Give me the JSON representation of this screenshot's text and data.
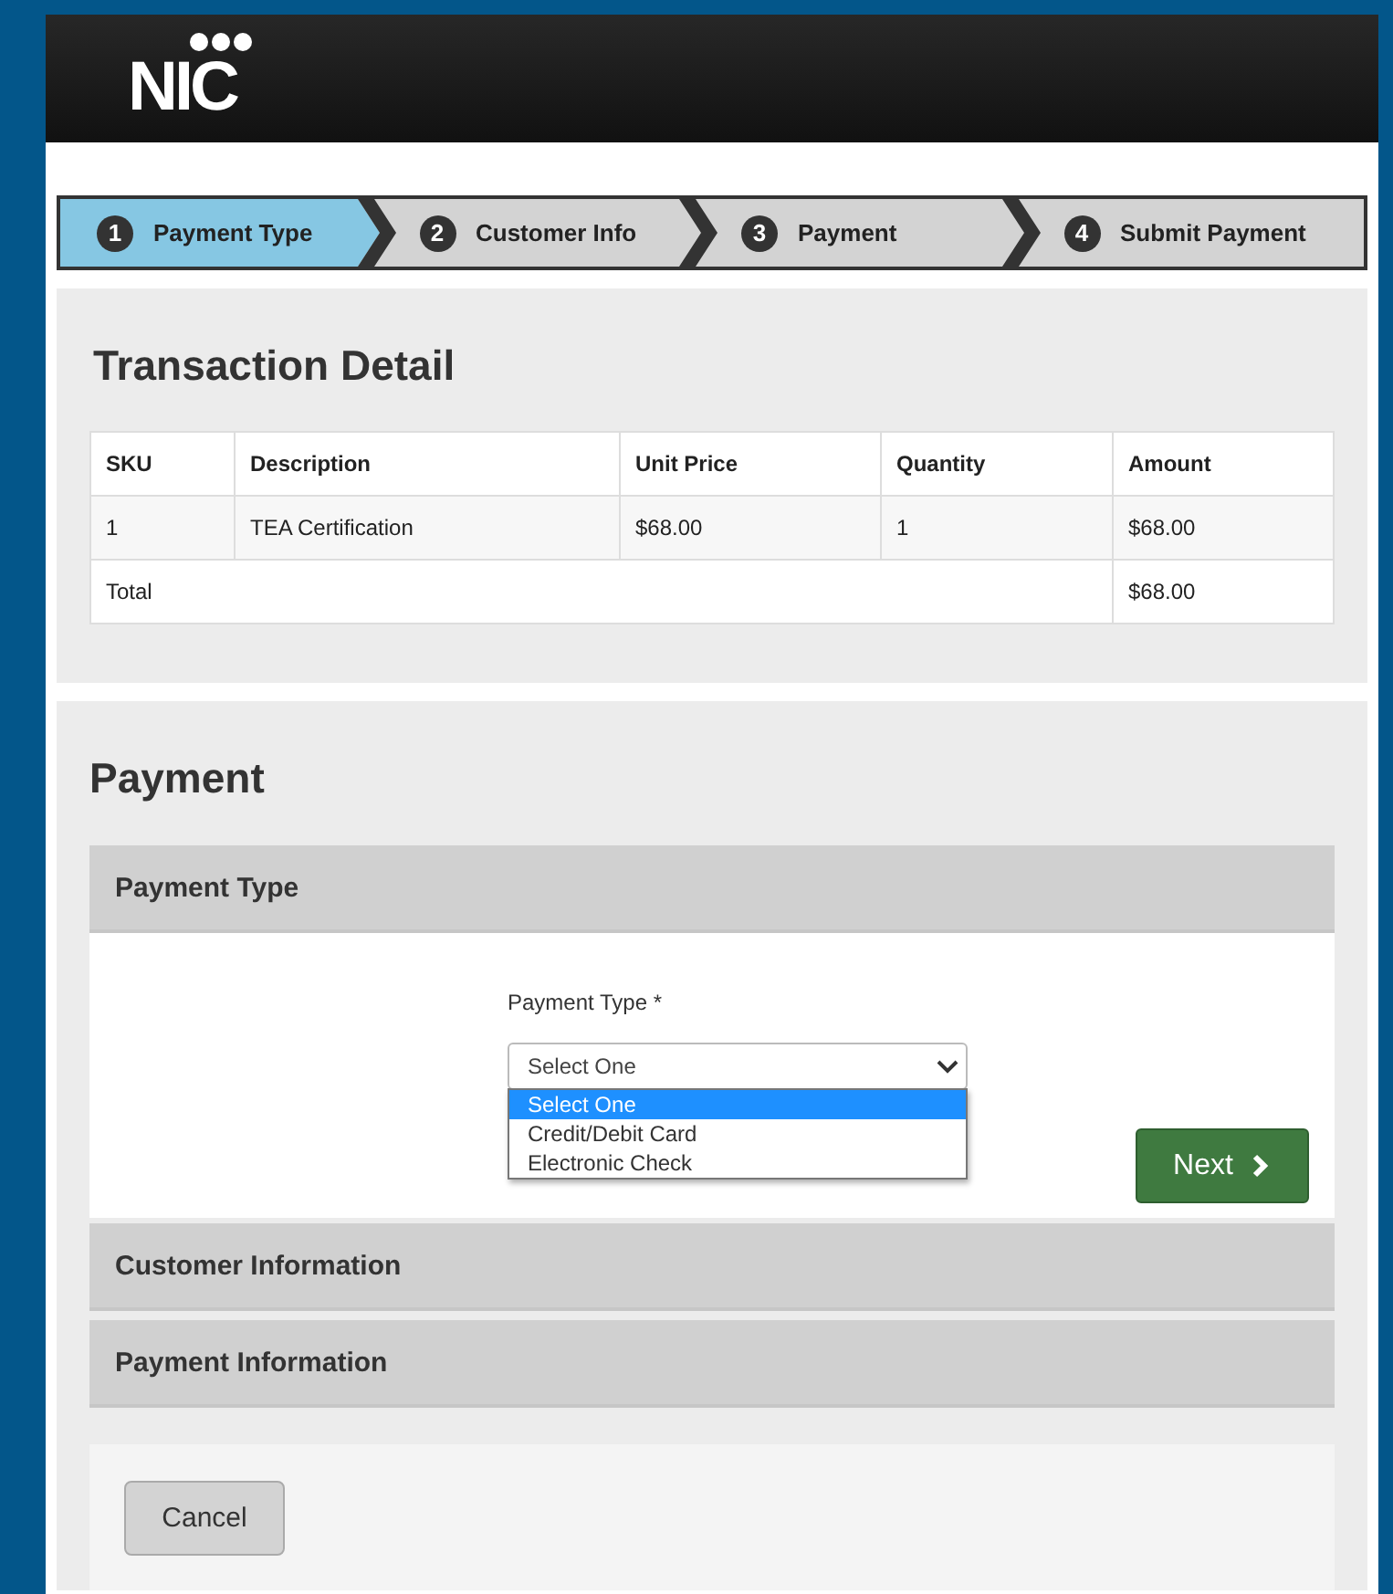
{
  "header": {
    "logo": "NIC"
  },
  "steps": [
    {
      "number": "1",
      "label": "Payment Type",
      "selected": true
    },
    {
      "number": "2",
      "label": "Customer Info",
      "selected": false
    },
    {
      "number": "3",
      "label": "Payment",
      "selected": false
    },
    {
      "number": "4",
      "label": "Submit Payment",
      "selected": false
    }
  ],
  "transaction": {
    "title": "Transaction Detail",
    "columns": [
      "SKU",
      "Description",
      "Unit Price",
      "Quantity",
      "Amount"
    ],
    "rows": [
      [
        "1",
        "TEA Certification",
        "$68.00",
        "1",
        "$68.00"
      ]
    ],
    "total": {
      "label": "Total",
      "amount": "$68.00"
    }
  },
  "payment": {
    "title": "Payment",
    "sections": [
      {
        "title": "Payment Type",
        "field": {
          "label": "Payment Type *",
          "value": "Select One",
          "options": [
            {
              "label": "Select One",
              "selected": true
            },
            {
              "label": "Credit/Debit Card",
              "selected": false
            },
            {
              "label": "Electronic Check",
              "selected": false
            }
          ]
        },
        "next": "Next"
      },
      {
        "title": "Customer Information"
      },
      {
        "title": "Payment Information"
      }
    ],
    "cancel": "Cancel"
  }
}
